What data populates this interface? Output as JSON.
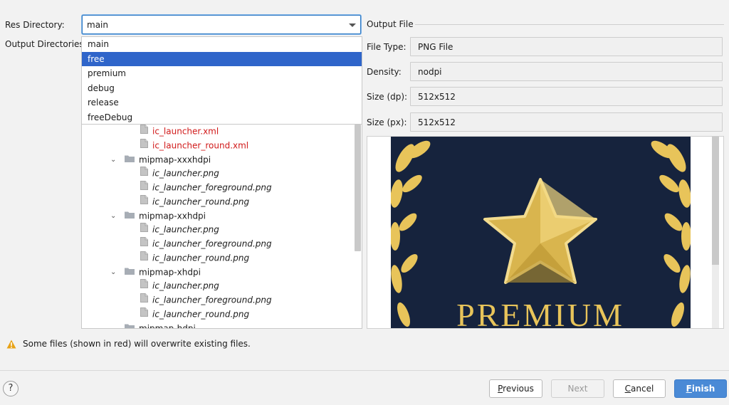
{
  "form": {
    "res_directory_label": "Res Directory:",
    "res_directory_value": "main",
    "output_directories_label": "Output Directories:"
  },
  "dropdown": {
    "options": [
      "main",
      "free",
      "premium",
      "debug",
      "release",
      "freeDebug"
    ],
    "selected": "free"
  },
  "tree": {
    "rows": [
      {
        "type": "file",
        "label": "ic_launcher.xml",
        "red": true,
        "depth": 2
      },
      {
        "type": "file",
        "label": "ic_launcher_round.xml",
        "red": true,
        "depth": 2
      },
      {
        "type": "folder",
        "label": "mipmap-xxxhdpi",
        "expanded": true,
        "depth": 1
      },
      {
        "type": "file",
        "label": "ic_launcher.png",
        "red": false,
        "depth": 2
      },
      {
        "type": "file",
        "label": "ic_launcher_foreground.png",
        "red": false,
        "depth": 2
      },
      {
        "type": "file",
        "label": "ic_launcher_round.png",
        "red": false,
        "depth": 2
      },
      {
        "type": "folder",
        "label": "mipmap-xxhdpi",
        "expanded": true,
        "depth": 1
      },
      {
        "type": "file",
        "label": "ic_launcher.png",
        "red": false,
        "depth": 2
      },
      {
        "type": "file",
        "label": "ic_launcher_foreground.png",
        "red": false,
        "depth": 2
      },
      {
        "type": "file",
        "label": "ic_launcher_round.png",
        "red": false,
        "depth": 2
      },
      {
        "type": "folder",
        "label": "mipmap-xhdpi",
        "expanded": true,
        "depth": 1
      },
      {
        "type": "file",
        "label": "ic_launcher.png",
        "red": false,
        "depth": 2
      },
      {
        "type": "file",
        "label": "ic_launcher_foreground.png",
        "red": false,
        "depth": 2
      },
      {
        "type": "file",
        "label": "ic_launcher_round.png",
        "red": false,
        "depth": 2
      },
      {
        "type": "folder",
        "label": "mipmap-hdpi",
        "expanded": true,
        "depth": 1
      }
    ]
  },
  "output_file": {
    "section_title": "Output File",
    "file_type_label": "File Type:",
    "file_type_value": "PNG File",
    "density_label": "Density:",
    "density_value": "nodpi",
    "size_dp_label": "Size (dp):",
    "size_dp_value": "512x512",
    "size_px_label": "Size (px):",
    "size_px_value": "512x512"
  },
  "preview": {
    "image_text": "PREMIUM",
    "bg_color": "#16233d",
    "gold_color": "#e8c45a"
  },
  "warning": {
    "icon": "warning-icon",
    "text": "Some files (shown in red) will overwrite existing files."
  },
  "buttons": {
    "help": "?",
    "previous_mnemonic": "P",
    "previous_rest": "revious",
    "next": "Next",
    "cancel_mnemonic": "C",
    "cancel_rest": "ancel",
    "finish_mnemonic": "F",
    "finish_rest": "inish"
  },
  "colors": {
    "accent": "#2f65ca",
    "overwrite_red": "#d11a1a",
    "primary_button": "#4a8ad6"
  }
}
